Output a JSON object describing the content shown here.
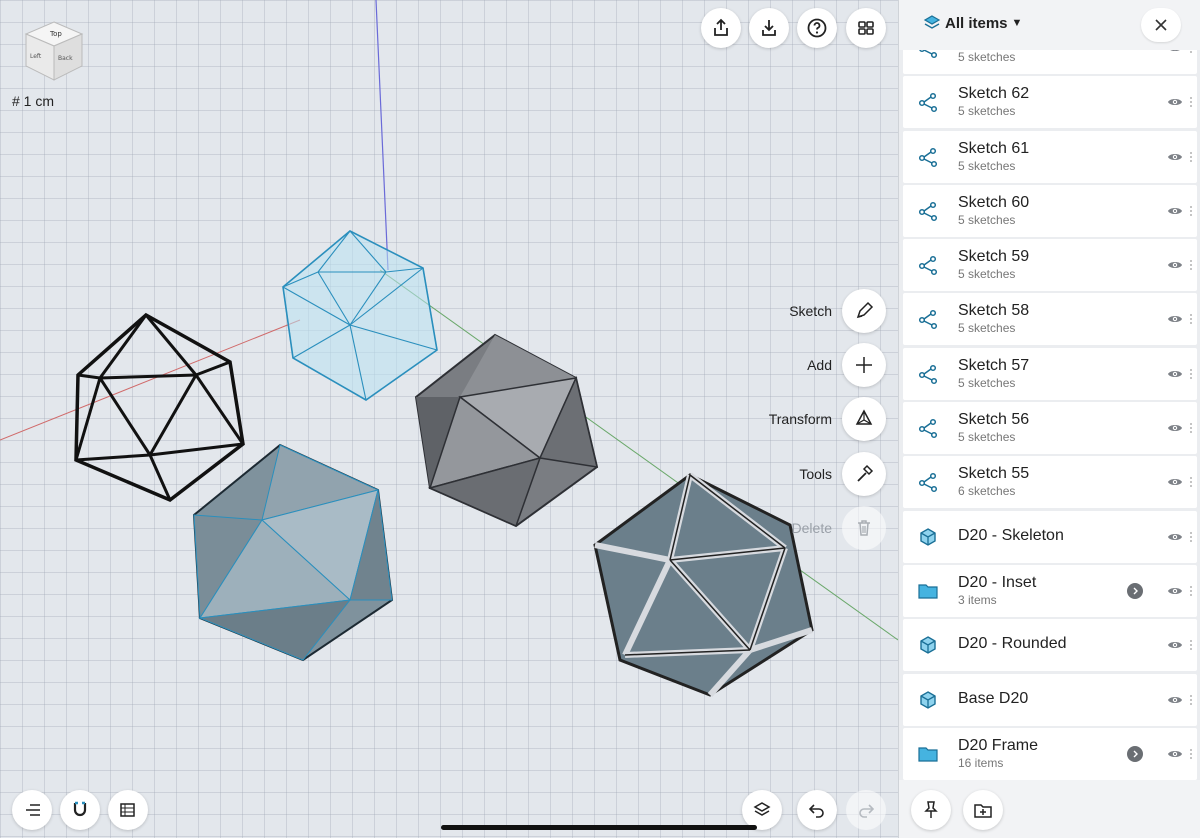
{
  "viewport": {
    "view_cube": {
      "top": "Top",
      "left": "Left",
      "back": "Back"
    },
    "grid_scale": "# 1 cm",
    "top_toolbar": [
      {
        "name": "share-icon"
      },
      {
        "name": "import-icon"
      },
      {
        "name": "help-icon"
      },
      {
        "name": "grid-view-icon"
      }
    ],
    "tools": [
      {
        "label": "Sketch",
        "icon": "pen-icon",
        "enabled": true
      },
      {
        "label": "Add",
        "icon": "plus-icon",
        "enabled": true
      },
      {
        "label": "Transform",
        "icon": "transform-icon",
        "enabled": true
      },
      {
        "label": "Tools",
        "icon": "hammer-icon",
        "enabled": true
      },
      {
        "label": "Delete",
        "icon": "trash-icon",
        "enabled": false
      }
    ],
    "bottom_left": [
      "menu-icon",
      "snap-magnet-icon",
      "layers-stack-icon"
    ],
    "bottom_right": [
      "layers-icon",
      "undo-icon",
      "redo-icon"
    ]
  },
  "panel": {
    "title": "All items",
    "items": [
      {
        "name": "",
        "sub": "5 sketches",
        "type": "sketch"
      },
      {
        "name": "Sketch 62",
        "sub": "5 sketches",
        "type": "sketch"
      },
      {
        "name": "Sketch 61",
        "sub": "5 sketches",
        "type": "sketch"
      },
      {
        "name": "Sketch 60",
        "sub": "5 sketches",
        "type": "sketch"
      },
      {
        "name": "Sketch 59",
        "sub": "5 sketches",
        "type": "sketch"
      },
      {
        "name": "Sketch 58",
        "sub": "5 sketches",
        "type": "sketch"
      },
      {
        "name": "Sketch 57",
        "sub": "5 sketches",
        "type": "sketch"
      },
      {
        "name": "Sketch 56",
        "sub": "5 sketches",
        "type": "sketch"
      },
      {
        "name": "Sketch 55",
        "sub": "6 sketches",
        "type": "sketch"
      },
      {
        "name": "D20 - Skeleton",
        "sub": "",
        "type": "body"
      },
      {
        "name": "D20 - Inset",
        "sub": "3 items",
        "type": "folder"
      },
      {
        "name": "D20 - Rounded",
        "sub": "",
        "type": "body"
      },
      {
        "name": "Base D20",
        "sub": "",
        "type": "body"
      },
      {
        "name": "D20 Frame",
        "sub": "16 items",
        "type": "folder"
      }
    ],
    "footer": [
      "pin-icon",
      "new-folder-icon"
    ]
  },
  "colors": {
    "accent": "#2a8fbd",
    "selected": "#9fd3ea",
    "folder": "#45b3e0"
  }
}
